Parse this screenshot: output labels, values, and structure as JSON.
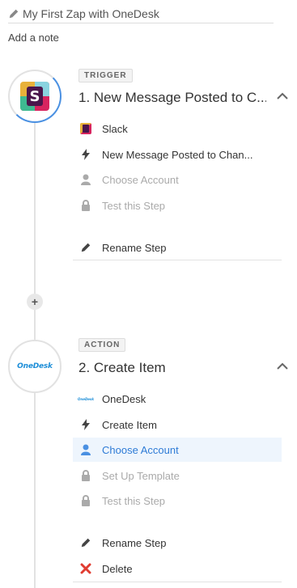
{
  "header": {
    "title": "My First Zap with OneDesk",
    "add_note": "Add a note"
  },
  "colors": {
    "accent": "#4a90e2",
    "danger": "#e03c31",
    "muted": "#aaaaaa"
  },
  "steps": [
    {
      "badge": "TRIGGER",
      "title": "1. New Message Posted to C...",
      "app_icon": "slack-icon",
      "items": [
        {
          "label": "Slack",
          "icon": "slack-icon",
          "state": "normal"
        },
        {
          "label": "New Message Posted to Chan...",
          "icon": "lightning-icon",
          "state": "normal"
        },
        {
          "label": "Choose Account",
          "icon": "user-icon",
          "state": "disabled"
        },
        {
          "label": "Test this Step",
          "icon": "lock-icon",
          "state": "disabled"
        }
      ],
      "rename_label": "Rename Step"
    },
    {
      "badge": "ACTION",
      "title": "2. Create Item",
      "app_icon": "onedesk-icon",
      "app_logo_text": "OneDesk",
      "items": [
        {
          "label": "OneDesk",
          "icon": "onedesk-icon",
          "state": "normal"
        },
        {
          "label": "Create Item",
          "icon": "lightning-icon",
          "state": "normal"
        },
        {
          "label": "Choose Account",
          "icon": "user-icon",
          "state": "selected"
        },
        {
          "label": "Set Up Template",
          "icon": "lock-icon",
          "state": "disabled"
        },
        {
          "label": "Test this Step",
          "icon": "lock-icon",
          "state": "disabled"
        }
      ],
      "rename_label": "Rename Step",
      "delete_label": "Delete"
    }
  ]
}
